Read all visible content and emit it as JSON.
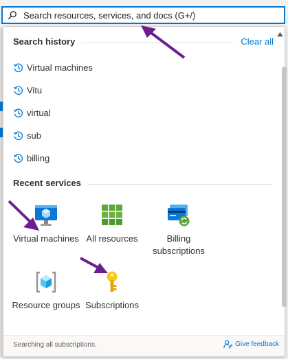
{
  "search": {
    "placeholder": "Search resources, services, and docs (G+/)"
  },
  "history": {
    "heading": "Search history",
    "clear_label": "Clear all",
    "items": [
      {
        "label": "Virtual machines"
      },
      {
        "label": "Vitu"
      },
      {
        "label": "virtual"
      },
      {
        "label": "sub"
      },
      {
        "label": "billing"
      }
    ]
  },
  "recent": {
    "heading": "Recent services",
    "services": [
      {
        "label": "Virtual machines",
        "icon": "virtual-machine-icon"
      },
      {
        "label": "All resources",
        "icon": "grid-icon"
      },
      {
        "label": "Billing subscriptions",
        "icon": "billing-card-icon"
      },
      {
        "label": "Resource groups",
        "icon": "resource-group-icon"
      },
      {
        "label": "Subscriptions",
        "icon": "key-icon"
      }
    ]
  },
  "footer": {
    "status": "Searching all subscriptions.",
    "feedback_label": "Give feedback"
  },
  "colors": {
    "accent": "#0078d4",
    "annotation_arrow": "#6b1f8f"
  }
}
